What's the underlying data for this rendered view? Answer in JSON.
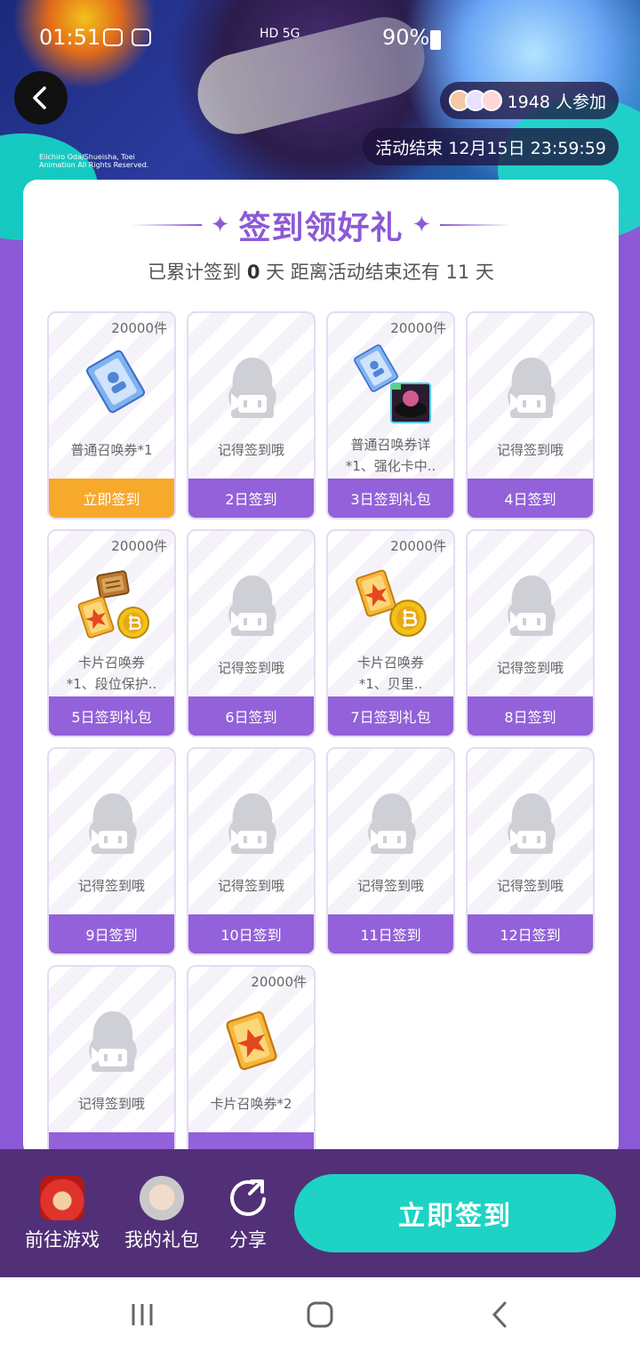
{
  "status_bar": {
    "time": "01:51",
    "network": "HD 5G",
    "battery": "90%"
  },
  "hero": {
    "copyright": "Eiichiro Oda/Shueisha, Toei Animation All Rights Reserved.",
    "participants": "1948 人参加",
    "end_time": "活动结束 12月15日 23:59:59"
  },
  "card": {
    "title": "签到领好礼",
    "subtitle_prefix": "已累计签到",
    "signed_days": "0",
    "subtitle_mid": "天  距离活动结束还有 11 天"
  },
  "days": [
    {
      "count": "20000件",
      "name": "普通召唤券*1",
      "button": "立即签到",
      "icon": "summon-ticket"
    },
    {
      "count": "",
      "name": "记得签到哦",
      "button": "2日签到",
      "icon": "placeholder"
    },
    {
      "count": "20000件",
      "name": "普通召唤券详\n*1、强化卡中..",
      "button": "3日签到礼包",
      "icon": "ticket-and-card"
    },
    {
      "count": "",
      "name": "记得签到哦",
      "button": "4日签到",
      "icon": "placeholder"
    },
    {
      "count": "20000件",
      "name": "卡片召唤券\n*1、段位保护..",
      "button": "5日签到礼包",
      "icon": "card-coin-protect"
    },
    {
      "count": "",
      "name": "记得签到哦",
      "button": "6日签到",
      "icon": "placeholder"
    },
    {
      "count": "20000件",
      "name": "卡片召唤券\n*1、贝里..",
      "button": "7日签到礼包",
      "icon": "card-coin"
    },
    {
      "count": "",
      "name": "记得签到哦",
      "button": "8日签到",
      "icon": "placeholder"
    },
    {
      "count": "",
      "name": "记得签到哦",
      "button": "9日签到",
      "icon": "placeholder"
    },
    {
      "count": "",
      "name": "记得签到哦",
      "button": "10日签到",
      "icon": "placeholder"
    },
    {
      "count": "",
      "name": "记得签到哦",
      "button": "11日签到",
      "icon": "placeholder"
    },
    {
      "count": "",
      "name": "记得签到哦",
      "button": "12日签到",
      "icon": "placeholder"
    },
    {
      "count": "",
      "name": "记得签到哦",
      "button": "",
      "icon": "placeholder"
    },
    {
      "count": "20000件",
      "name": "卡片召唤券*2",
      "button": "",
      "icon": "card-summon"
    }
  ],
  "bottom_bar": {
    "game_label": "前往游戏",
    "gift_label": "我的礼包",
    "share_label": "分享",
    "checkin_label": "立即签到"
  },
  "colors": {
    "accent": "#8c59d6",
    "today": "#f7a92c",
    "teal": "#1ed3c4",
    "bottom": "#523077"
  }
}
